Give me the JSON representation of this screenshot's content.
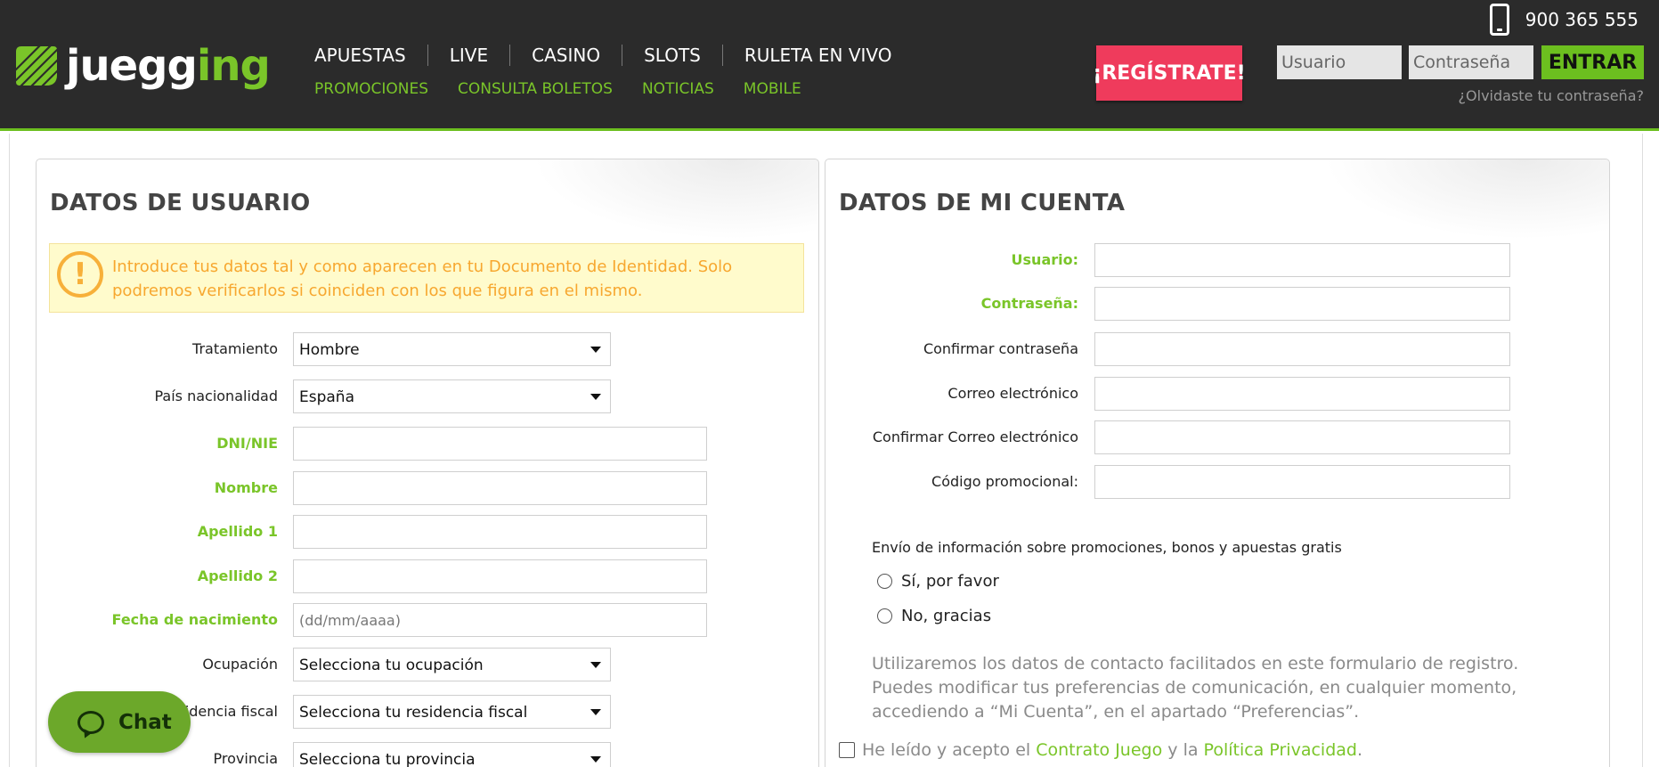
{
  "header": {
    "logo": {
      "text_main": "juegg",
      "text_accent": "ing"
    },
    "nav_primary": [
      "APUESTAS",
      "LIVE",
      "CASINO",
      "SLOTS",
      "RULETA EN VIVO"
    ],
    "nav_secondary": [
      "PROMOCIONES",
      "CONSULTA BOLETOS",
      "NOTICIAS",
      "MOBILE"
    ],
    "phone": "900 365 555",
    "register_label": "¡REGÍSTRATE!",
    "login": {
      "user_placeholder": "Usuario",
      "pass_placeholder": "Contraseña",
      "submit_label": "ENTRAR",
      "forgot_label": "¿Olvidaste tu contraseña?"
    }
  },
  "user_panel": {
    "title": "DATOS DE USUARIO",
    "notice": "Introduce tus datos tal y como aparecen en tu Documento de Identidad. Solo podremos verificarlos si coinciden con los que figura en el mismo.",
    "fields": {
      "tratamiento": {
        "label": "Tratamiento",
        "value": "Hombre"
      },
      "pais": {
        "label": "País nacionalidad",
        "value": "España"
      },
      "dni": {
        "label": "DNI/NIE"
      },
      "nombre": {
        "label": "Nombre"
      },
      "apellido1": {
        "label": "Apellido 1"
      },
      "apellido2": {
        "label": "Apellido 2"
      },
      "fecha": {
        "label": "Fecha de nacimiento",
        "placeholder": "(dd/mm/aaaa)"
      },
      "ocupacion": {
        "label": "Ocupación",
        "value": "Selecciona tu ocupación"
      },
      "residencia": {
        "label": "Residencia fiscal",
        "value": "Selecciona tu residencia fiscal"
      },
      "provincia": {
        "label": "Provincia",
        "value": "Selecciona tu provincia"
      }
    }
  },
  "account_panel": {
    "title": "DATOS DE MI CUENTA",
    "fields": {
      "usuario": {
        "label": "Usuario:"
      },
      "contrasena": {
        "label": "Contraseña:"
      },
      "confirmar_contrasena": {
        "label": "Confirmar contraseña"
      },
      "correo": {
        "label": "Correo electrónico"
      },
      "confirmar_correo": {
        "label": "Confirmar Correo electrónico"
      },
      "codigo": {
        "label": "Código promocional:"
      }
    },
    "promo_title": "Envío de información sobre promociones, bonos y apuestas gratis",
    "promo_yes": "Sí, por favor",
    "promo_no": "No, gracias",
    "privacy_text": "Utilizaremos los datos de contacto facilitados en este formulario de registro. Puedes modificar tus preferencias de comunicación, en cualquier momento, accediendo a “Mi Cuenta”, en el apartado “Preferencias”.",
    "accept": {
      "prefix": "He leído y acepto el",
      "link1": "Contrato Juego",
      "middle": "y la",
      "link2": "Política Privacidad",
      "suffix": "."
    }
  },
  "chat": {
    "label": "Chat"
  }
}
